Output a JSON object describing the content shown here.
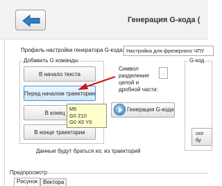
{
  "header": {
    "title": "Генерация G-кода ("
  },
  "profile": {
    "label": "Профиль настройки генератора G-кода:",
    "selected": "Настройка для фрезерного ЧПУ"
  },
  "command_group": {
    "label": "Добавить G команды",
    "buttons": [
      {
        "label": "В начало текста"
      },
      {
        "label": "Перед началом траектории"
      },
      {
        "label": "В конец тек"
      },
      {
        "label": "В конце траектории"
      }
    ]
  },
  "separator": {
    "lines": [
      "Символ",
      "разделения",
      "целой и",
      "дробной части:"
    ],
    "value": "."
  },
  "generate_button": {
    "label": "Генерация G-кода"
  },
  "gcode_group": {
    "label": "G-код",
    "side_button_lines": [
      "ско",
      "бу"
    ]
  },
  "tooltip": {
    "lines": [
      "M5",
      "G0 Z10",
      "G0 X0 Y0"
    ]
  },
  "info_text": "Данные будут браться из: из траекторий",
  "preview": {
    "label": "Предпросмотр",
    "tabs": [
      {
        "label": "Рисунок"
      },
      {
        "label": "Вектора"
      }
    ]
  },
  "colors": {
    "accent": "#3c96d6",
    "arrow": "#cc1a1a",
    "tooltip_bg": "#ffffcc"
  }
}
